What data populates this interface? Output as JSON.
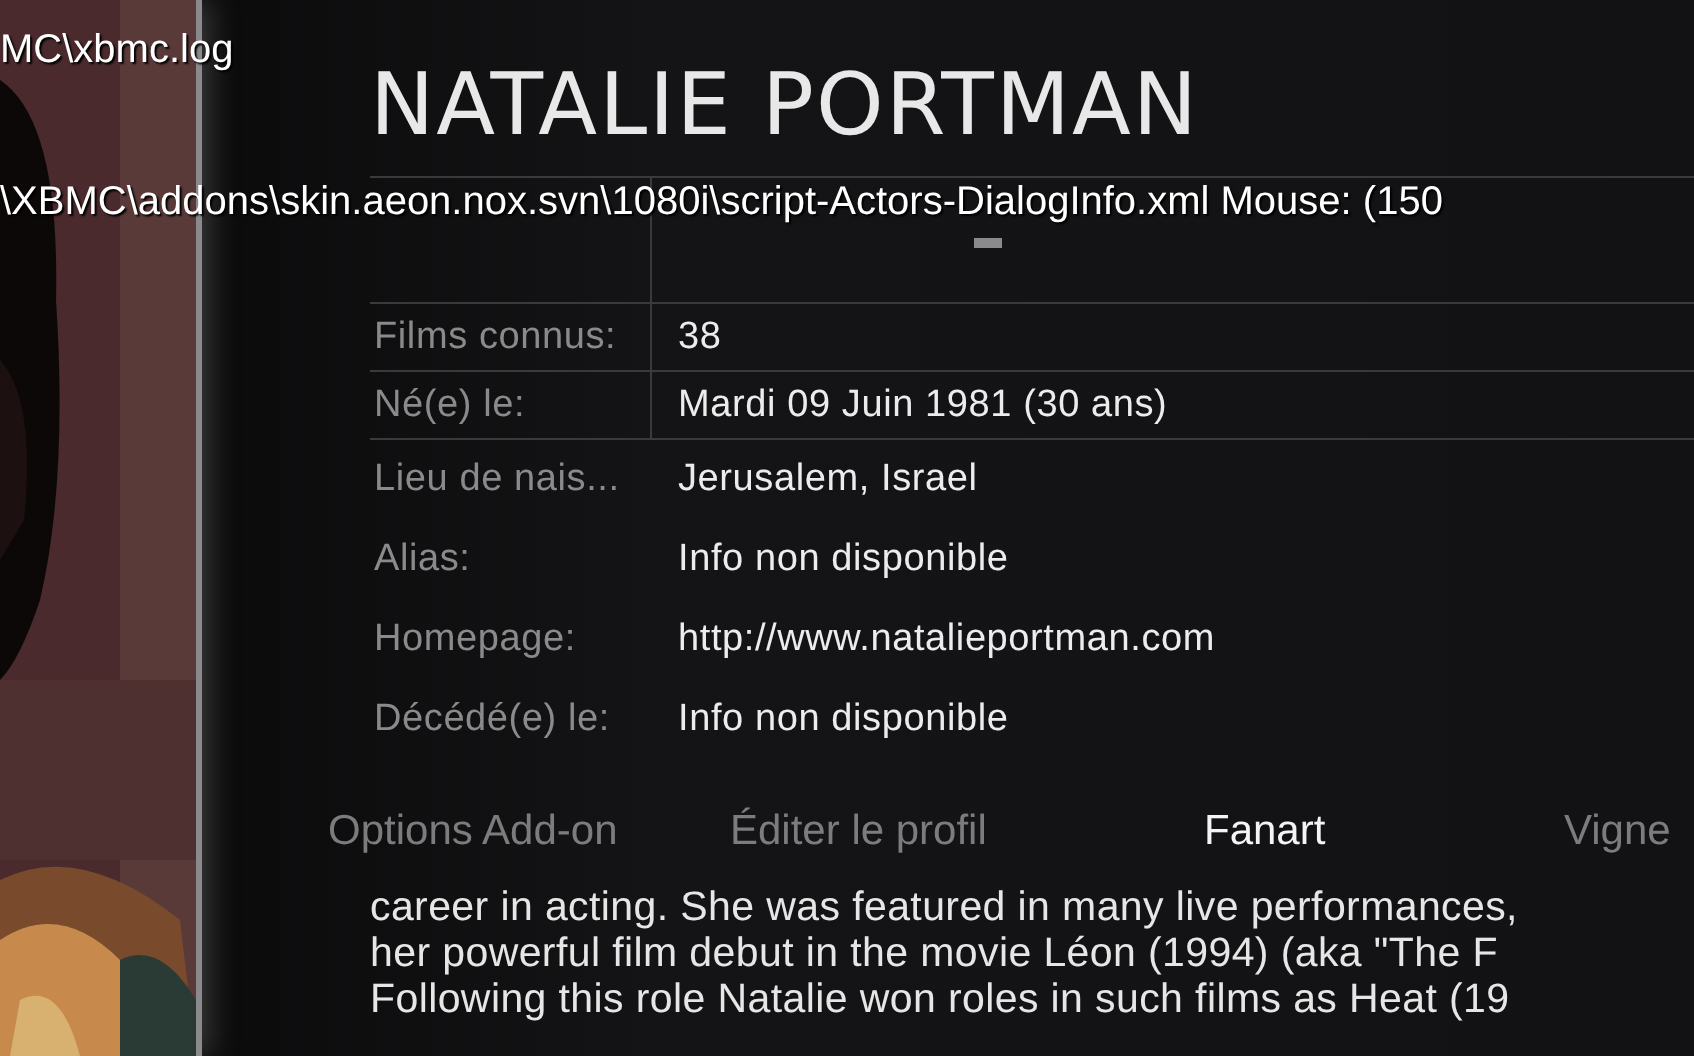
{
  "debug_overlay": {
    "log_path": "MC\\xbmc.log",
    "window_info": "\\XBMC\\addons\\skin.aeon.nox.svn\\1080i\\script-Actors-DialogInfo.xml  Mouse: (150"
  },
  "photo": {
    "kind": "picture"
  },
  "actor": {
    "name": "NATALIE PORTMAN"
  },
  "details": [
    {
      "label": "Films connus:",
      "value": "38"
    },
    {
      "label": "Né(e) le:",
      "value": "Mardi 09 Juin 1981 (30 ans)"
    },
    {
      "label": "Lieu de nais...",
      "value": "Jerusalem, Israel"
    },
    {
      "label": "Alias:",
      "value": "Info non disponible"
    },
    {
      "label": "Homepage:",
      "value": "http://www.natalieportman.com"
    },
    {
      "label": "Décédé(e) le:",
      "value": "Info non disponible"
    }
  ],
  "buttons": [
    {
      "label": "Options Add-on",
      "selected": false
    },
    {
      "label": "Éditer le profil",
      "selected": false
    },
    {
      "label": "Fanart",
      "selected": true
    },
    {
      "label": "Vigne",
      "selected": false
    }
  ],
  "biography": [
    "career in acting. She was featured in many live performances,",
    "her powerful film debut in the movie Léon (1994) (aka \"The F",
    "Following this role Natalie won roles in such films as Heat (19"
  ]
}
